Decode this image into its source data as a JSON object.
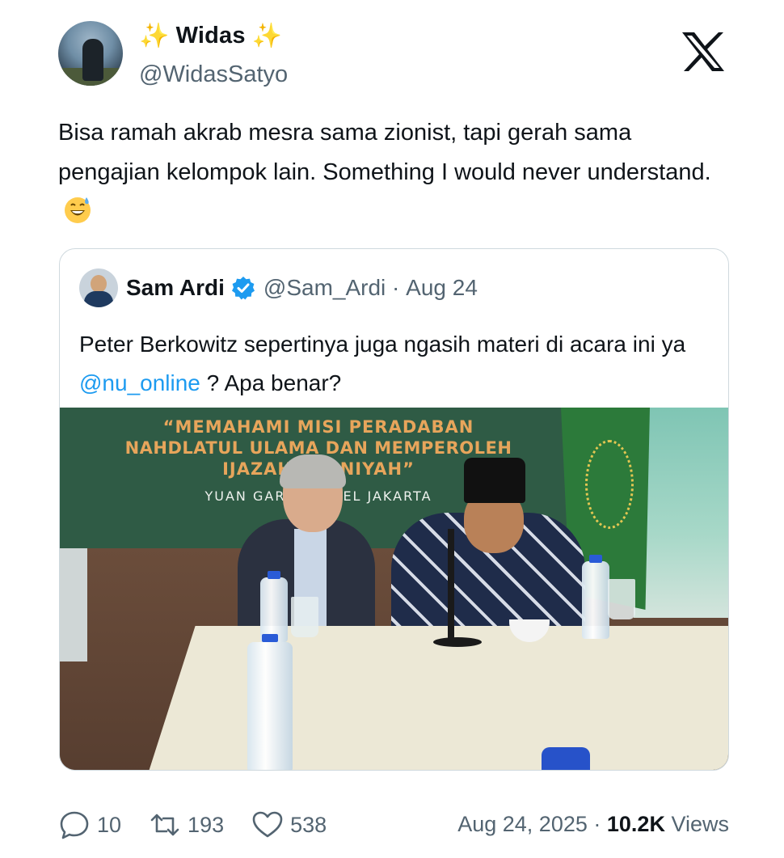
{
  "author": {
    "display_name": "Widas",
    "sparkle_left": "✨",
    "sparkle_right": "✨",
    "handle": "@WidasSatyo"
  },
  "tweet": {
    "text": "Bisa ramah akrab mesra sama zionist, tapi gerah sama pengajian kelompok lain. Something I would never understand.",
    "emoji": "grinning-face-with-sweat"
  },
  "quote": {
    "name": "Sam Ardi",
    "handle": "@Sam_Ardi",
    "separator": " · ",
    "date": "Aug 24",
    "text_before": "Peter Berkowitz sepertinya juga ngasih materi di acara ini ya ",
    "mention": "@nu_online",
    "text_after": " ? Apa benar?",
    "image_banner": {
      "line1": "“MEMAHAMI MISI PERADABAN",
      "line2": "NAHDLATUL ULAMA DAN MEMPEROLEH",
      "line3": "IJAZAH R    NIYAH”",
      "line4": "YUAN GARD        EL JAKARTA"
    }
  },
  "stats": {
    "replies": "10",
    "reposts": "193",
    "likes": "538",
    "date": "Aug 24, 2025",
    "separator": " · ",
    "views_count": "10.2K",
    "views_label": " Views"
  },
  "colors": {
    "text": "#0f1419",
    "secondary": "#536471",
    "link": "#1d9bf0",
    "verified": "#1d9bf0",
    "border": "#cfd9de"
  }
}
